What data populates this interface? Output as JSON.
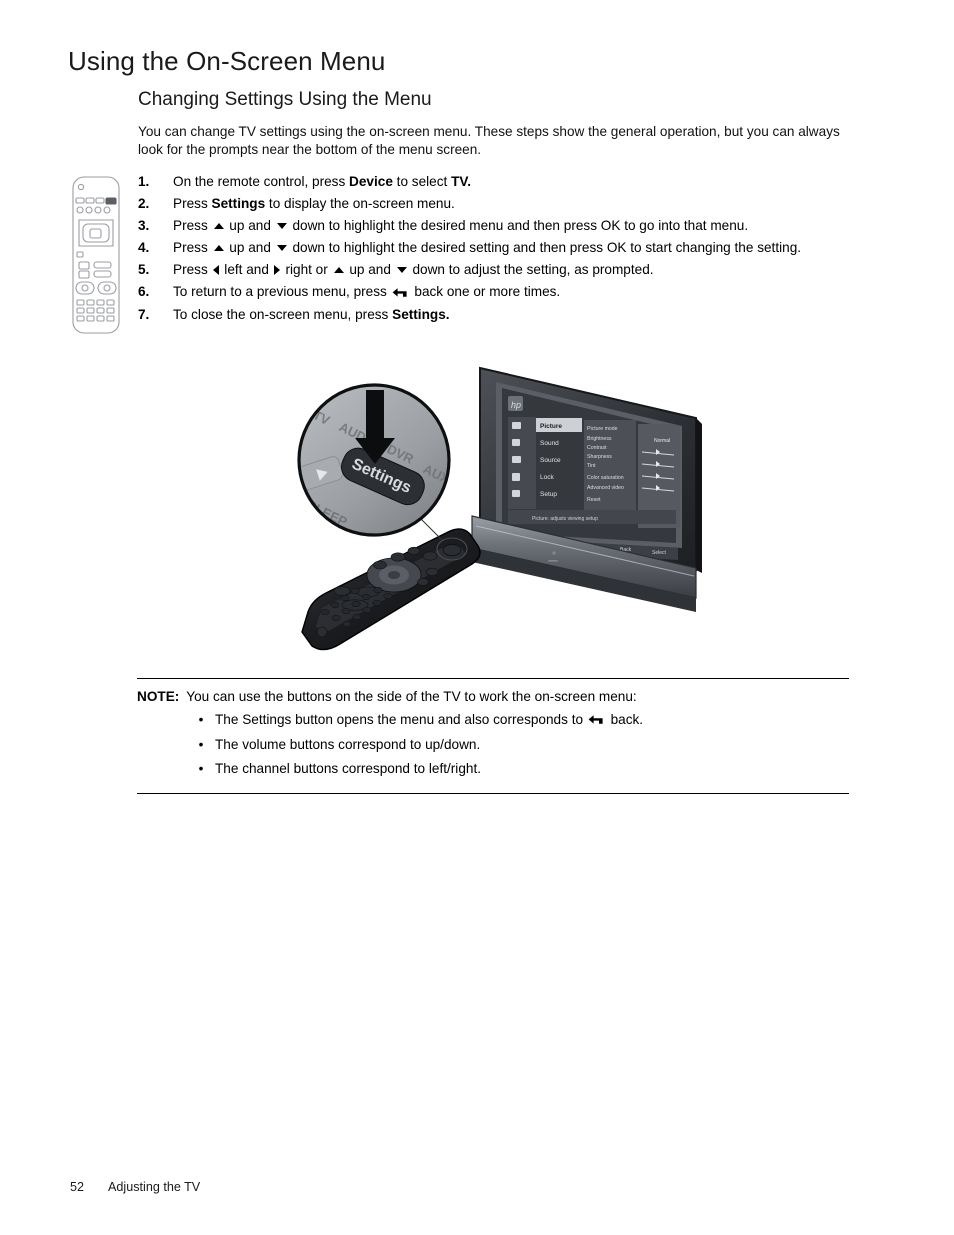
{
  "document": {
    "page_title": "Using the On-Screen Menu",
    "section_title": "Changing Settings Using the Menu",
    "intro_paragraph": "You can change TV settings using the on-screen menu. These steps show the general operation, but you can always look for the prompts near the bottom of the menu screen."
  },
  "steps": [
    {
      "number": "1.",
      "parts": [
        {
          "t": "text",
          "v": "On the remote control, press "
        },
        {
          "t": "bold",
          "v": "Device"
        },
        {
          "t": "text",
          "v": " to select "
        },
        {
          "t": "bold",
          "v": "TV."
        }
      ]
    },
    {
      "number": "2.",
      "parts": [
        {
          "t": "text",
          "v": "Press "
        },
        {
          "t": "bold",
          "v": "Settings"
        },
        {
          "t": "text",
          "v": " to display the on-screen menu."
        }
      ]
    },
    {
      "number": "3.",
      "parts": [
        {
          "t": "text",
          "v": "Press "
        },
        {
          "t": "icon",
          "v": "triangle-up-icon"
        },
        {
          "t": "text",
          "v": " up and "
        },
        {
          "t": "icon",
          "v": "triangle-down-icon"
        },
        {
          "t": "text",
          "v": " down to highlight the desired menu and then press OK to go into that menu."
        }
      ]
    },
    {
      "number": "4.",
      "parts": [
        {
          "t": "text",
          "v": "Press "
        },
        {
          "t": "icon",
          "v": "triangle-up-icon"
        },
        {
          "t": "text",
          "v": " up and "
        },
        {
          "t": "icon",
          "v": "triangle-down-icon"
        },
        {
          "t": "text",
          "v": " down to highlight the desired setting and then press OK to start changing the setting."
        }
      ]
    },
    {
      "number": "5.",
      "parts": [
        {
          "t": "text",
          "v": "Press "
        },
        {
          "t": "icon",
          "v": "triangle-left-icon"
        },
        {
          "t": "text",
          "v": " left and "
        },
        {
          "t": "icon",
          "v": "triangle-right-icon"
        },
        {
          "t": "text",
          "v": " right or "
        },
        {
          "t": "icon",
          "v": "triangle-up-icon"
        },
        {
          "t": "text",
          "v": " up and "
        },
        {
          "t": "icon",
          "v": "triangle-down-icon"
        },
        {
          "t": "text",
          "v": " down to adjust the setting, as prompted."
        }
      ]
    },
    {
      "number": "6.",
      "parts": [
        {
          "t": "text",
          "v": "To return to a previous menu, press "
        },
        {
          "t": "icon",
          "v": "back-arrow-icon"
        },
        {
          "t": "text",
          "v": " back one or more times."
        }
      ]
    },
    {
      "number": "7.",
      "parts": [
        {
          "t": "text",
          "v": "To close the on-screen menu, press "
        },
        {
          "t": "bold",
          "v": "Settings."
        }
      ]
    }
  ],
  "note": {
    "label": "NOTE:",
    "intro": "You can use the buttons on the side of the TV to work the on-screen menu:",
    "bullet_marker": "•",
    "bullets": [
      {
        "parts": [
          {
            "t": "text",
            "v": "The Settings button opens the menu and also corresponds to "
          },
          {
            "t": "icon",
            "v": "back-arrow-icon"
          },
          {
            "t": "text",
            "v": " back."
          }
        ]
      },
      {
        "parts": [
          {
            "t": "text",
            "v": "The volume buttons correspond to up/down."
          }
        ]
      },
      {
        "parts": [
          {
            "t": "text",
            "v": "The channel buttons correspond to left/right."
          }
        ]
      }
    ]
  },
  "illustration": {
    "alt_name": "remote-and-tv-illustration",
    "callout_button_label": "Settings",
    "callout_mode_labels": "TV AUDIO DVR AUX",
    "callout_sleep_label": "SLEEP",
    "tv_logo": "hp",
    "tv_menu_items": [
      "Picture",
      "Sound",
      "Source",
      "Lock",
      "Setup"
    ],
    "tv_submenu_items": [
      "Picture mode",
      "Brightness",
      "Contrast",
      "Sharpness",
      "Tint",
      "Color saturation",
      "Advanced video",
      "Reset"
    ],
    "tv_prompt_bar": "Picture: adjusts viewing setup"
  },
  "footer": {
    "page_number": "52",
    "chapter": "Adjusting the TV"
  },
  "colors": {
    "page_background": "#ffffff",
    "text": "#111111",
    "rule": "#000000",
    "device_dark": "#2b2d31",
    "device_mid": "#56595e",
    "device_light": "#9a9da2",
    "screen_dark": "#3a3d42",
    "screen_panel": "#5a5d63"
  }
}
